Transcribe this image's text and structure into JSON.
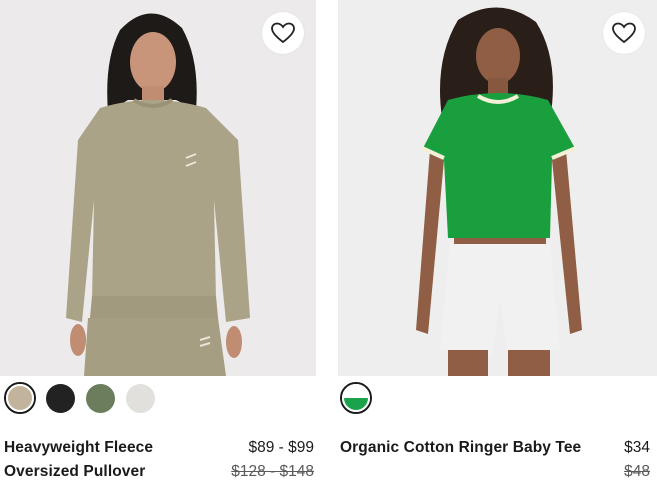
{
  "products": [
    {
      "name_line1": "Heavyweight Fleece",
      "name_line2": "Oversized Pullover",
      "price": "$89 - $99",
      "original_price": "$128 - $148",
      "swatch_colors": [
        "#c2b49c",
        "#222222",
        "#6b7d5c",
        "#e2e0dc"
      ],
      "image_bg": "#eceaea"
    },
    {
      "name": "Organic Cotton Ringer Baby Tee",
      "price": "$34",
      "original_price": "$48",
      "swatch_colors": [
        "#1aa34a"
      ],
      "image_bg": "#eeeeee"
    }
  ],
  "icons": {
    "wishlist": "heart-outline-icon"
  }
}
